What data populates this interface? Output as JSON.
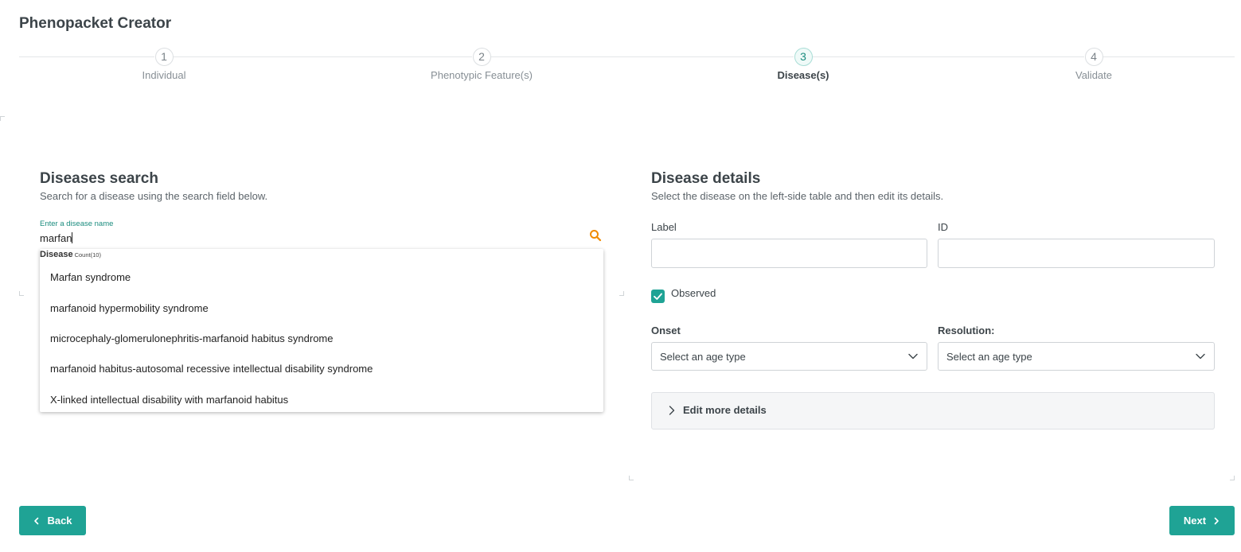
{
  "app": {
    "title": "Phenopacket Creator"
  },
  "stepper": {
    "steps": [
      {
        "number": "1",
        "label": "Individual"
      },
      {
        "number": "2",
        "label": "Phenotypic Feature(s)"
      },
      {
        "number": "3",
        "label": "Disease(s)"
      },
      {
        "number": "4",
        "label": "Validate"
      }
    ],
    "active_index": 2
  },
  "search_panel": {
    "title": "Diseases search",
    "subtitle": "Search for a disease using the search field below.",
    "input_label": "Enter a disease name",
    "input_value": "marfan",
    "search_icon": "search-icon",
    "dropdown": {
      "header": "Disease",
      "count": "Count(10)",
      "items": [
        "Marfan syndrome",
        "marfanoid hypermobility syndrome",
        "microcephaly-glomerulonephritis-marfanoid habitus syndrome",
        "marfanoid habitus-autosomal recessive intellectual disability syndrome",
        "X-linked intellectual disability with marfanoid habitus"
      ]
    }
  },
  "details_panel": {
    "title": "Disease details",
    "subtitle": "Select the disease on the left-side table and then edit its details.",
    "label_field": {
      "label": "Label",
      "value": ""
    },
    "id_field": {
      "label": "ID",
      "value": ""
    },
    "observed": {
      "label": "Observed",
      "checked": true
    },
    "onset": {
      "label": "Onset",
      "placeholder": "Select an age type"
    },
    "resolution": {
      "label": "Resolution:",
      "placeholder": "Select an age type"
    },
    "more_details": "Edit more details"
  },
  "footer": {
    "back_label": "Back",
    "next_label": "Next"
  },
  "colors": {
    "accent": "#1fa395",
    "search_icon": "#f08a00"
  }
}
